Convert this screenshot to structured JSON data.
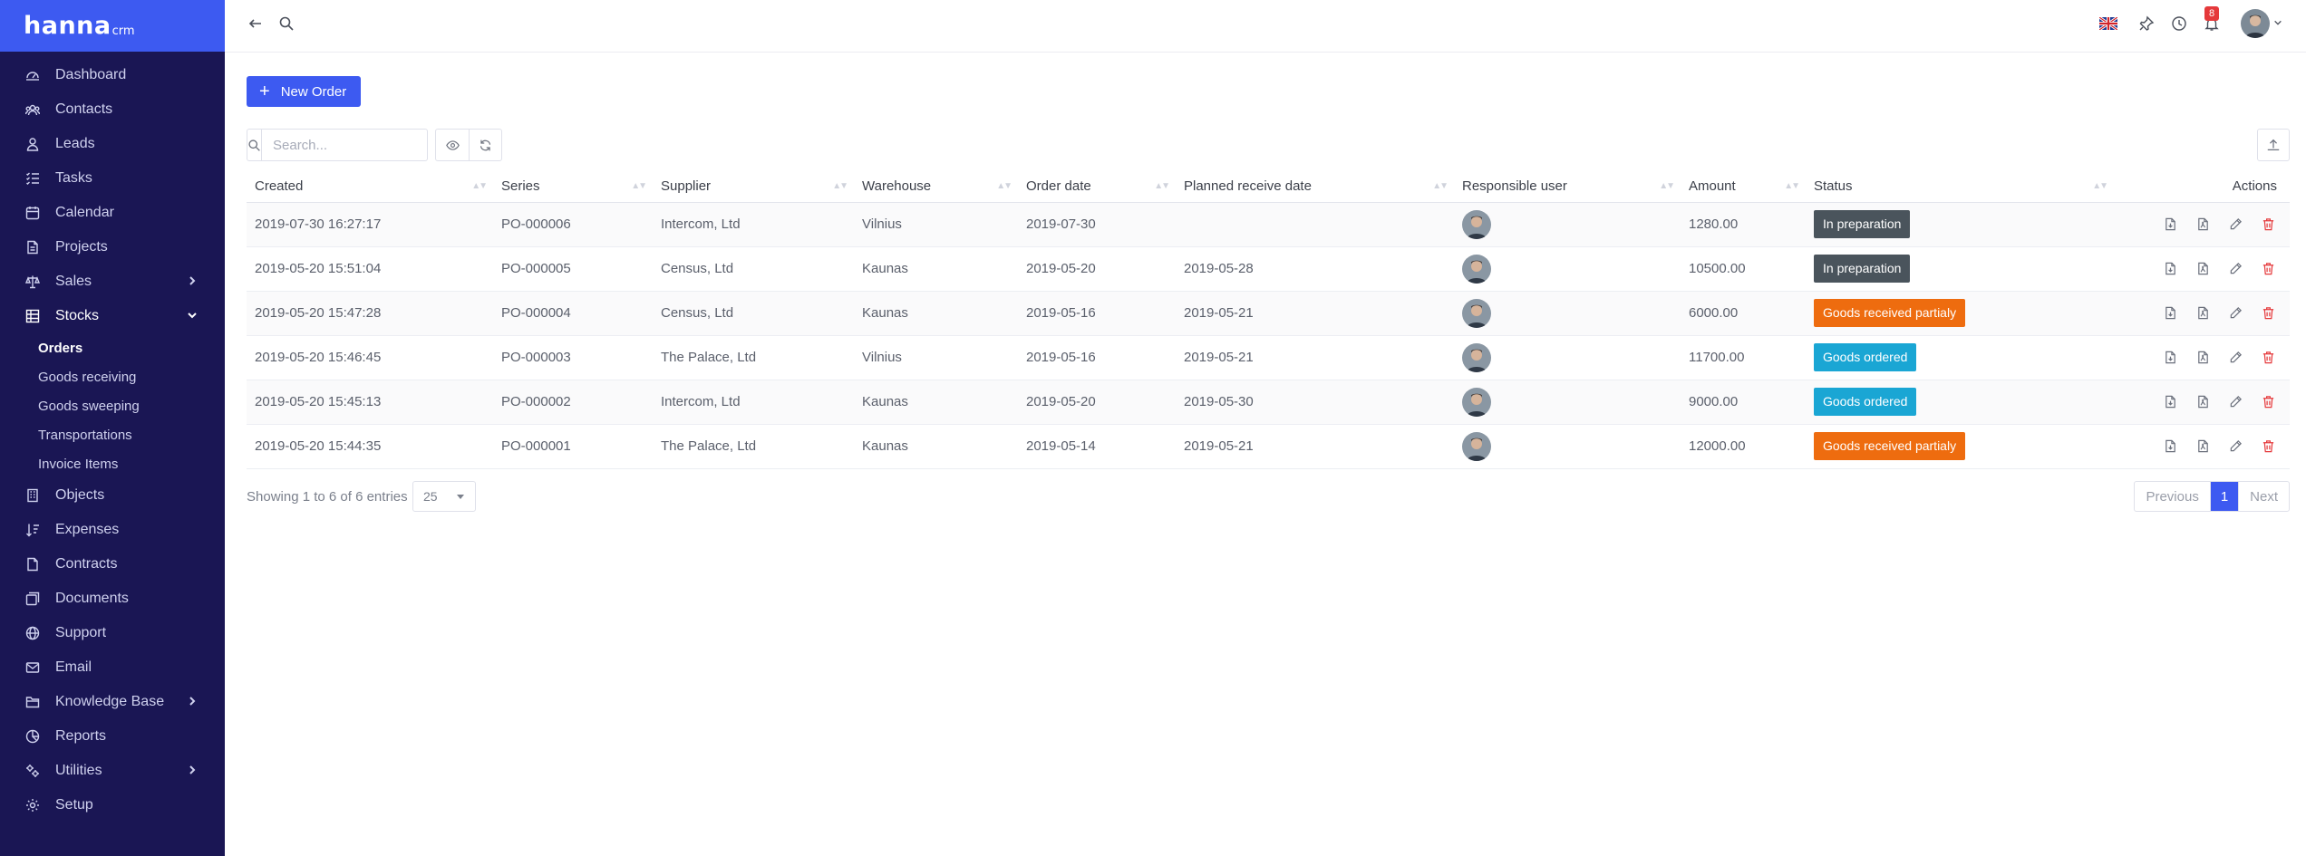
{
  "brand": {
    "main": "hanna",
    "sub": "crm"
  },
  "sidebar": {
    "items": [
      {
        "label": "Dashboard",
        "icon": "dashboard-icon"
      },
      {
        "label": "Contacts",
        "icon": "contacts-icon"
      },
      {
        "label": "Leads",
        "icon": "leads-icon"
      },
      {
        "label": "Tasks",
        "icon": "tasks-icon"
      },
      {
        "label": "Calendar",
        "icon": "calendar-icon"
      },
      {
        "label": "Projects",
        "icon": "projects-icon"
      },
      {
        "label": "Sales",
        "icon": "sales-icon"
      },
      {
        "label": "Stocks",
        "icon": "stocks-icon"
      },
      {
        "label": "Objects",
        "icon": "objects-icon"
      },
      {
        "label": "Expenses",
        "icon": "expenses-icon"
      },
      {
        "label": "Contracts",
        "icon": "contracts-icon"
      },
      {
        "label": "Documents",
        "icon": "documents-icon"
      },
      {
        "label": "Support",
        "icon": "support-icon"
      },
      {
        "label": "Email",
        "icon": "email-icon"
      },
      {
        "label": "Knowledge Base",
        "icon": "knowledge-base-icon"
      },
      {
        "label": "Reports",
        "icon": "reports-icon"
      },
      {
        "label": "Utilities",
        "icon": "utilities-icon"
      },
      {
        "label": "Setup",
        "icon": "setup-icon"
      }
    ],
    "stocks_sub": [
      {
        "label": "Orders"
      },
      {
        "label": "Goods receiving"
      },
      {
        "label": "Goods sweeping"
      },
      {
        "label": "Transportations"
      },
      {
        "label": "Invoice Items"
      }
    ]
  },
  "topbar": {
    "notifications_count": "8"
  },
  "toolbar": {
    "new_order_label": "New Order",
    "search_placeholder": "Search..."
  },
  "table": {
    "headers": [
      "Created",
      "Series",
      "Supplier",
      "Warehouse",
      "Order date",
      "Planned receive date",
      "Responsible user",
      "Amount",
      "Status",
      "Actions"
    ],
    "rows": [
      {
        "created": "2019-07-30 16:27:17",
        "series": "PO-000006",
        "supplier": "Intercom, Ltd",
        "warehouse": "Vilnius",
        "order_date": "2019-07-30",
        "planned": "",
        "amount": "1280.00",
        "status": "In preparation",
        "status_color": "#4a545c"
      },
      {
        "created": "2019-05-20 15:51:04",
        "series": "PO-000005",
        "supplier": "Census, Ltd",
        "warehouse": "Kaunas",
        "order_date": "2019-05-20",
        "planned": "2019-05-28",
        "amount": "10500.00",
        "status": "In preparation",
        "status_color": "#4a545c"
      },
      {
        "created": "2019-05-20 15:47:28",
        "series": "PO-000004",
        "supplier": "Census, Ltd",
        "warehouse": "Kaunas",
        "order_date": "2019-05-16",
        "planned": "2019-05-21",
        "amount": "6000.00",
        "status": "Goods received partialy",
        "status_color": "#ee6c0f"
      },
      {
        "created": "2019-05-20 15:46:45",
        "series": "PO-000003",
        "supplier": "The Palace, Ltd",
        "warehouse": "Vilnius",
        "order_date": "2019-05-16",
        "planned": "2019-05-21",
        "amount": "11700.00",
        "status": "Goods ordered",
        "status_color": "#1aa6d4"
      },
      {
        "created": "2019-05-20 15:45:13",
        "series": "PO-000002",
        "supplier": "Intercom, Ltd",
        "warehouse": "Kaunas",
        "order_date": "2019-05-20",
        "planned": "2019-05-30",
        "amount": "9000.00",
        "status": "Goods ordered",
        "status_color": "#1aa6d4"
      },
      {
        "created": "2019-05-20 15:44:35",
        "series": "PO-000001",
        "supplier": "The Palace, Ltd",
        "warehouse": "Kaunas",
        "order_date": "2019-05-14",
        "planned": "2019-05-21",
        "amount": "12000.00",
        "status": "Goods received partialy",
        "status_color": "#ee6c0f"
      }
    ]
  },
  "footer": {
    "info": "Showing 1 to 6 of 6 entries",
    "page_size": "25",
    "prev": "Previous",
    "current_page": "1",
    "next": "Next"
  },
  "colors": {
    "sidebar_bg": "#1a1654",
    "accent": "#3d5af1",
    "delete": "#e5393b"
  }
}
